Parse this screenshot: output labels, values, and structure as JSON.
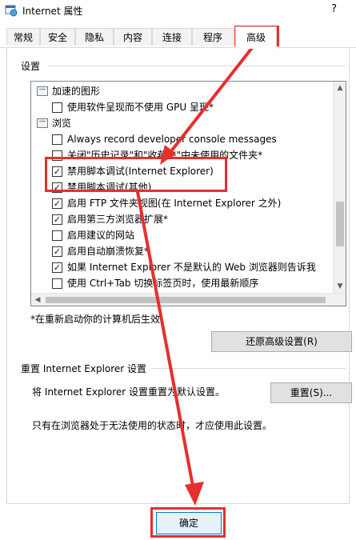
{
  "window": {
    "title": "Internet 属性",
    "help": "?"
  },
  "tabs": [
    "常规",
    "安全",
    "隐私",
    "内容",
    "连接",
    "程序",
    "高级"
  ],
  "active_tab": "高级",
  "settings": {
    "group_title": "设置",
    "items": [
      {
        "kind": "category",
        "label": "加速的图形"
      },
      {
        "kind": "checkbox",
        "checked": false,
        "label": "使用软件呈现而不使用 GPU 呈现*"
      },
      {
        "kind": "category",
        "label": "浏览"
      },
      {
        "kind": "checkbox",
        "checked": false,
        "label": "Always record developer console messages"
      },
      {
        "kind": "checkbox",
        "checked": false,
        "label": "关闭\"历史记录\"和\"收藏夹\"中未使用的文件夹*"
      },
      {
        "kind": "checkbox",
        "checked": true,
        "label": "禁用脚本调试(Internet Explorer)"
      },
      {
        "kind": "checkbox",
        "checked": true,
        "label": "禁用脚本调试(其他)"
      },
      {
        "kind": "checkbox",
        "checked": true,
        "label": "启用 FTP 文件夹视图(在 Internet Explorer 之外)"
      },
      {
        "kind": "checkbox",
        "checked": true,
        "label": "启用第三方浏览器扩展*"
      },
      {
        "kind": "checkbox",
        "checked": false,
        "label": "启用建议的网站"
      },
      {
        "kind": "checkbox",
        "checked": true,
        "label": "启用自动崩溃恢复*"
      },
      {
        "kind": "checkbox",
        "checked": true,
        "label": "如果 Internet Explorer 不是默认的 Web 浏览器则告诉我"
      },
      {
        "kind": "checkbox",
        "checked": false,
        "label": "使用 Ctrl+Tab 切换标签页时，使用最新顺序"
      }
    ],
    "restart_note": "*在重新启动你的计算机后生效",
    "restore_button": "还原高级设置(R)"
  },
  "reset": {
    "group_title": "重置 Internet Explorer 设置",
    "description": "将 Internet Explorer 设置重置为默认设置。",
    "button": "重置(S)...",
    "warning": "只有在浏览器处于无法使用的状态时，才应使用此设置。"
  },
  "footer": {
    "ok_button": "确定"
  },
  "colors": {
    "annotation_red": "#e5302e"
  }
}
